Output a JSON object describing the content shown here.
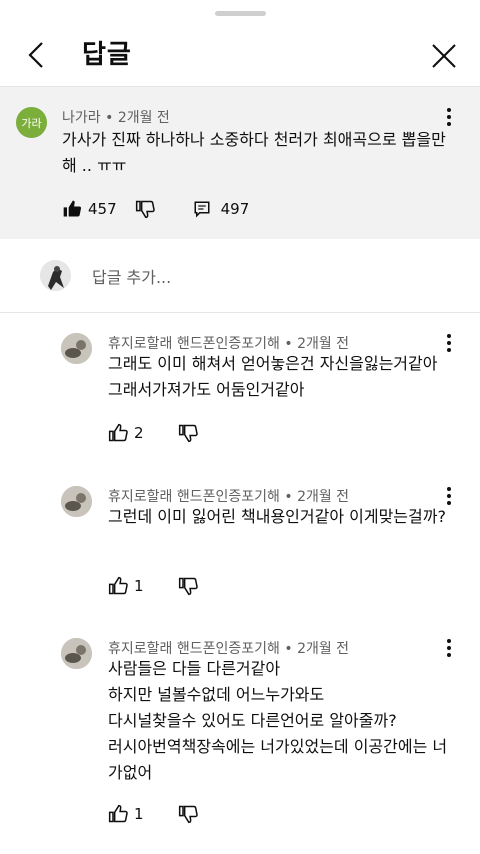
{
  "header": {
    "title": "답글"
  },
  "parent_comment": {
    "avatar_text": "가라",
    "author": "나가라",
    "time": "2개월 전",
    "text": "가사가 진짜 하나하나 소중하다 천러가 최애곡으로 뽑을만 해 .. ㅠㅠ",
    "likes": "457",
    "replies": "497"
  },
  "add_reply": {
    "placeholder": "답글 추가..."
  },
  "replies": [
    {
      "author": "휴지로할래 핸드폰인증포기해",
      "time": "2개월 전",
      "text": "그래도 이미 해쳐서 얻어놓은건 자신을잃는거같아 그래서가져가도 어둠인거같아",
      "likes": "2"
    },
    {
      "author": "휴지로할래 핸드폰인증포기해",
      "time": "2개월 전",
      "text": "그런데 이미 잃어린 책내용인거같아 이게맞는걸까?",
      "likes": "1"
    },
    {
      "author": "휴지로할래 핸드폰인증포기해",
      "time": "2개월 전",
      "text": "사람들은 다들 다른거같아\n하지만 널볼수없데 어느누가와도\n다시널찾을수 있어도 다른언어로 알아줄까?\n러시아번역책장속에는 너가있었는데 이공간에는 너가없어",
      "likes": "1"
    }
  ],
  "meta_separator": "•",
  "colors": {
    "avatar_parent": "#7cae3b",
    "parent_bg": "#f2f2f2",
    "meta_text": "#606060"
  },
  "icons": [
    "chevron-left-icon",
    "close-icon",
    "more-vert-icon",
    "thumb-up-icon",
    "thumb-down-icon",
    "reply-icon"
  ]
}
